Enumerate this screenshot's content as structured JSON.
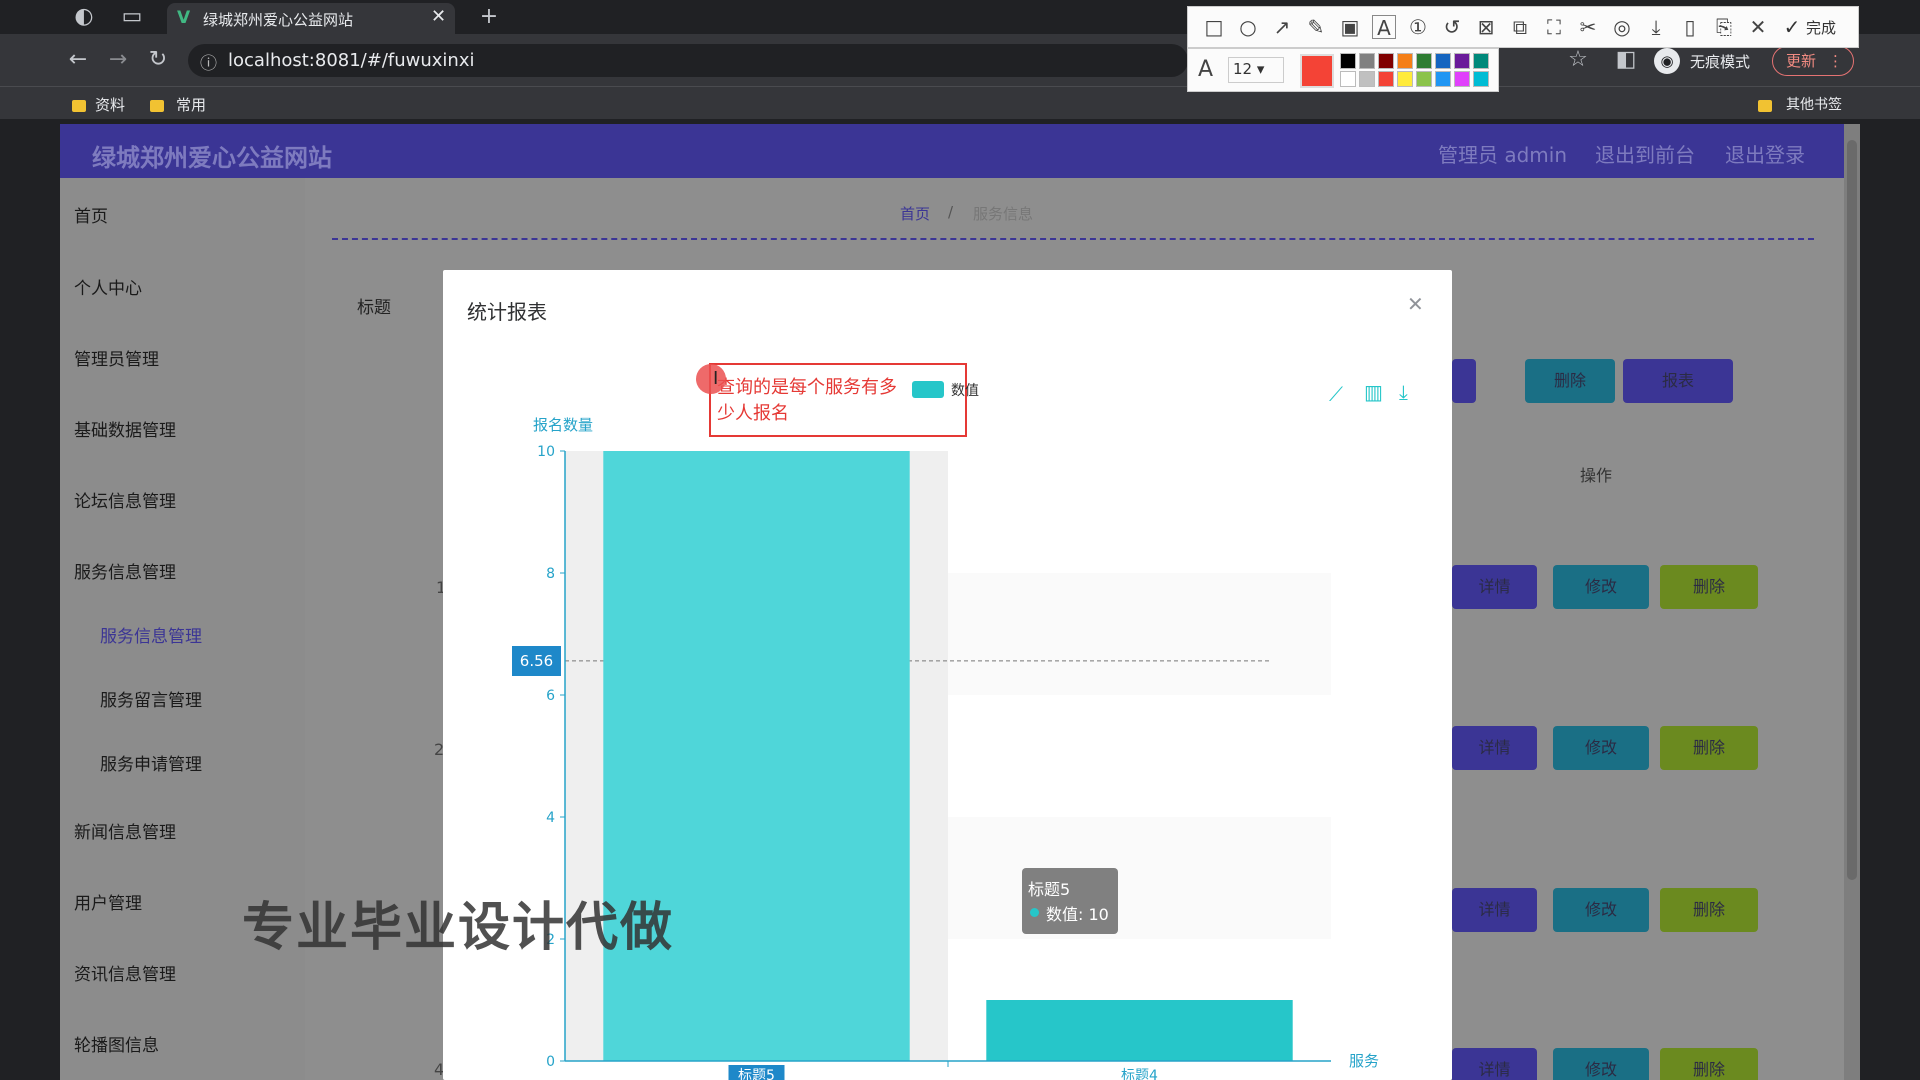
{
  "browser": {
    "tab_title": "绿城郑州爱心公益网站",
    "url": "localhost:8081/#/fuwuxinxi",
    "incognito_label": "无痕模式",
    "update_label": "更新",
    "bookmarks": [
      "资料",
      "常用"
    ],
    "other_bookmarks": "其他书签",
    "annot_done": "完成",
    "annot_font_size": "12"
  },
  "app": {
    "site_title": "绿城郑州爱心公益网站",
    "admin_label": "管理员 admin",
    "to_front_label": "退出到前台",
    "logout_label": "退出登录",
    "breadcrumb_home": "首页",
    "breadcrumb_current": "服务信息",
    "search_label": "标题",
    "column_actions": "操作",
    "row_nums": [
      "1",
      "2",
      "4"
    ],
    "btn_delete": "删除",
    "btn_report": "报表",
    "btn_detail": "详情",
    "btn_edit": "修改"
  },
  "sidebar": {
    "items": [
      "首页",
      "个人中心",
      "管理员管理",
      "基础数据管理",
      "论坛信息管理",
      "服务信息管理",
      "新闻信息管理",
      "用户管理",
      "资讯信息管理",
      "轮播图信息"
    ],
    "sub_items": [
      "服务信息管理",
      "服务留言管理",
      "服务申请管理"
    ]
  },
  "modal": {
    "title": "统计报表",
    "annotation_text": "查询的是每个服务有多少人报名"
  },
  "chart_data": {
    "type": "bar",
    "title": "",
    "ylabel": "报名数量",
    "xlabel": "服务",
    "categories": [
      "标题5",
      "标题4"
    ],
    "series": [
      {
        "name": "数值",
        "values": [
          10,
          1
        ]
      }
    ],
    "ylim": [
      0,
      10
    ],
    "yticks": [
      "0",
      "2",
      "4",
      "6",
      "8",
      "10"
    ],
    "pointer_value": "6.56",
    "tooltip": {
      "category": "标题5",
      "label": "数值: 10"
    },
    "bar_color": "#4fd6d9",
    "legend_position": "top-center",
    "grid": false
  },
  "watermark": "专业毕业设计代做"
}
